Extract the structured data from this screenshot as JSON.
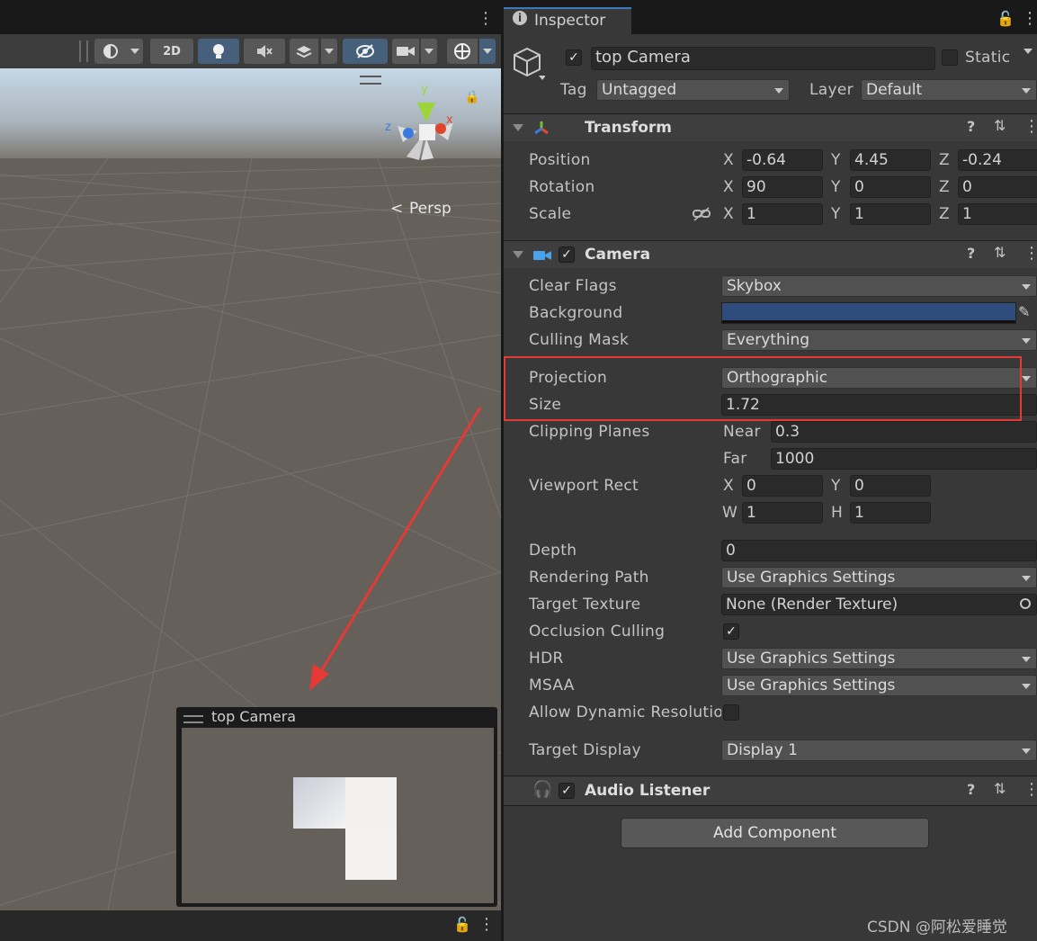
{
  "scene": {
    "toolbar": {
      "mode_2d": "2D"
    },
    "persp_label": "Persp",
    "gizmo": {
      "y": "y",
      "x": "x",
      "z": "z"
    },
    "camera_preview_title": "top Camera"
  },
  "inspector": {
    "tab_title": "Inspector",
    "object_name": "top Camera",
    "static_label": "Static",
    "tag_label": "Tag",
    "tag_value": "Untagged",
    "layer_label": "Layer",
    "layer_value": "Default",
    "transform": {
      "title": "Transform",
      "position_label": "Position",
      "rotation_label": "Rotation",
      "scale_label": "Scale",
      "position": {
        "x": "-0.64",
        "y": "4.45",
        "z": "-0.24"
      },
      "rotation": {
        "x": "90",
        "y": "0",
        "z": "0"
      },
      "scale": {
        "x": "1",
        "y": "1",
        "z": "1"
      }
    },
    "axes": {
      "x": "X",
      "y": "Y",
      "z": "Z",
      "w": "W",
      "h": "H"
    },
    "camera": {
      "title": "Camera",
      "clear_flags_label": "Clear Flags",
      "clear_flags": "Skybox",
      "background_label": "Background",
      "background_color": "#2e4c7c",
      "culling_mask_label": "Culling Mask",
      "culling_mask": "Everything",
      "projection_label": "Projection",
      "projection": "Orthographic",
      "size_label": "Size",
      "size": "1.72",
      "clipping_planes_label": "Clipping Planes",
      "near_label": "Near",
      "near": "0.3",
      "far_label": "Far",
      "far": "1000",
      "viewport_rect_label": "Viewport Rect",
      "viewport": {
        "x": "0",
        "y": "0",
        "w": "1",
        "h": "1"
      },
      "depth_label": "Depth",
      "depth": "0",
      "rendering_path_label": "Rendering Path",
      "rendering_path": "Use Graphics Settings",
      "target_texture_label": "Target Texture",
      "target_texture": "None (Render Texture)",
      "occlusion_culling_label": "Occlusion Culling",
      "hdr_label": "HDR",
      "hdr": "Use Graphics Settings",
      "msaa_label": "MSAA",
      "msaa": "Use Graphics Settings",
      "allow_dynamic_label": "Allow Dynamic Resolutio",
      "target_display_label": "Target Display",
      "target_display": "Display 1"
    },
    "audio_listener_title": "Audio Listener",
    "add_component": "Add Component"
  },
  "watermark": "CSDN @阿松爱睡觉",
  "colors": {
    "accent": "#3a79bb",
    "highlight": "#e53935",
    "arrow": "#e53935"
  }
}
